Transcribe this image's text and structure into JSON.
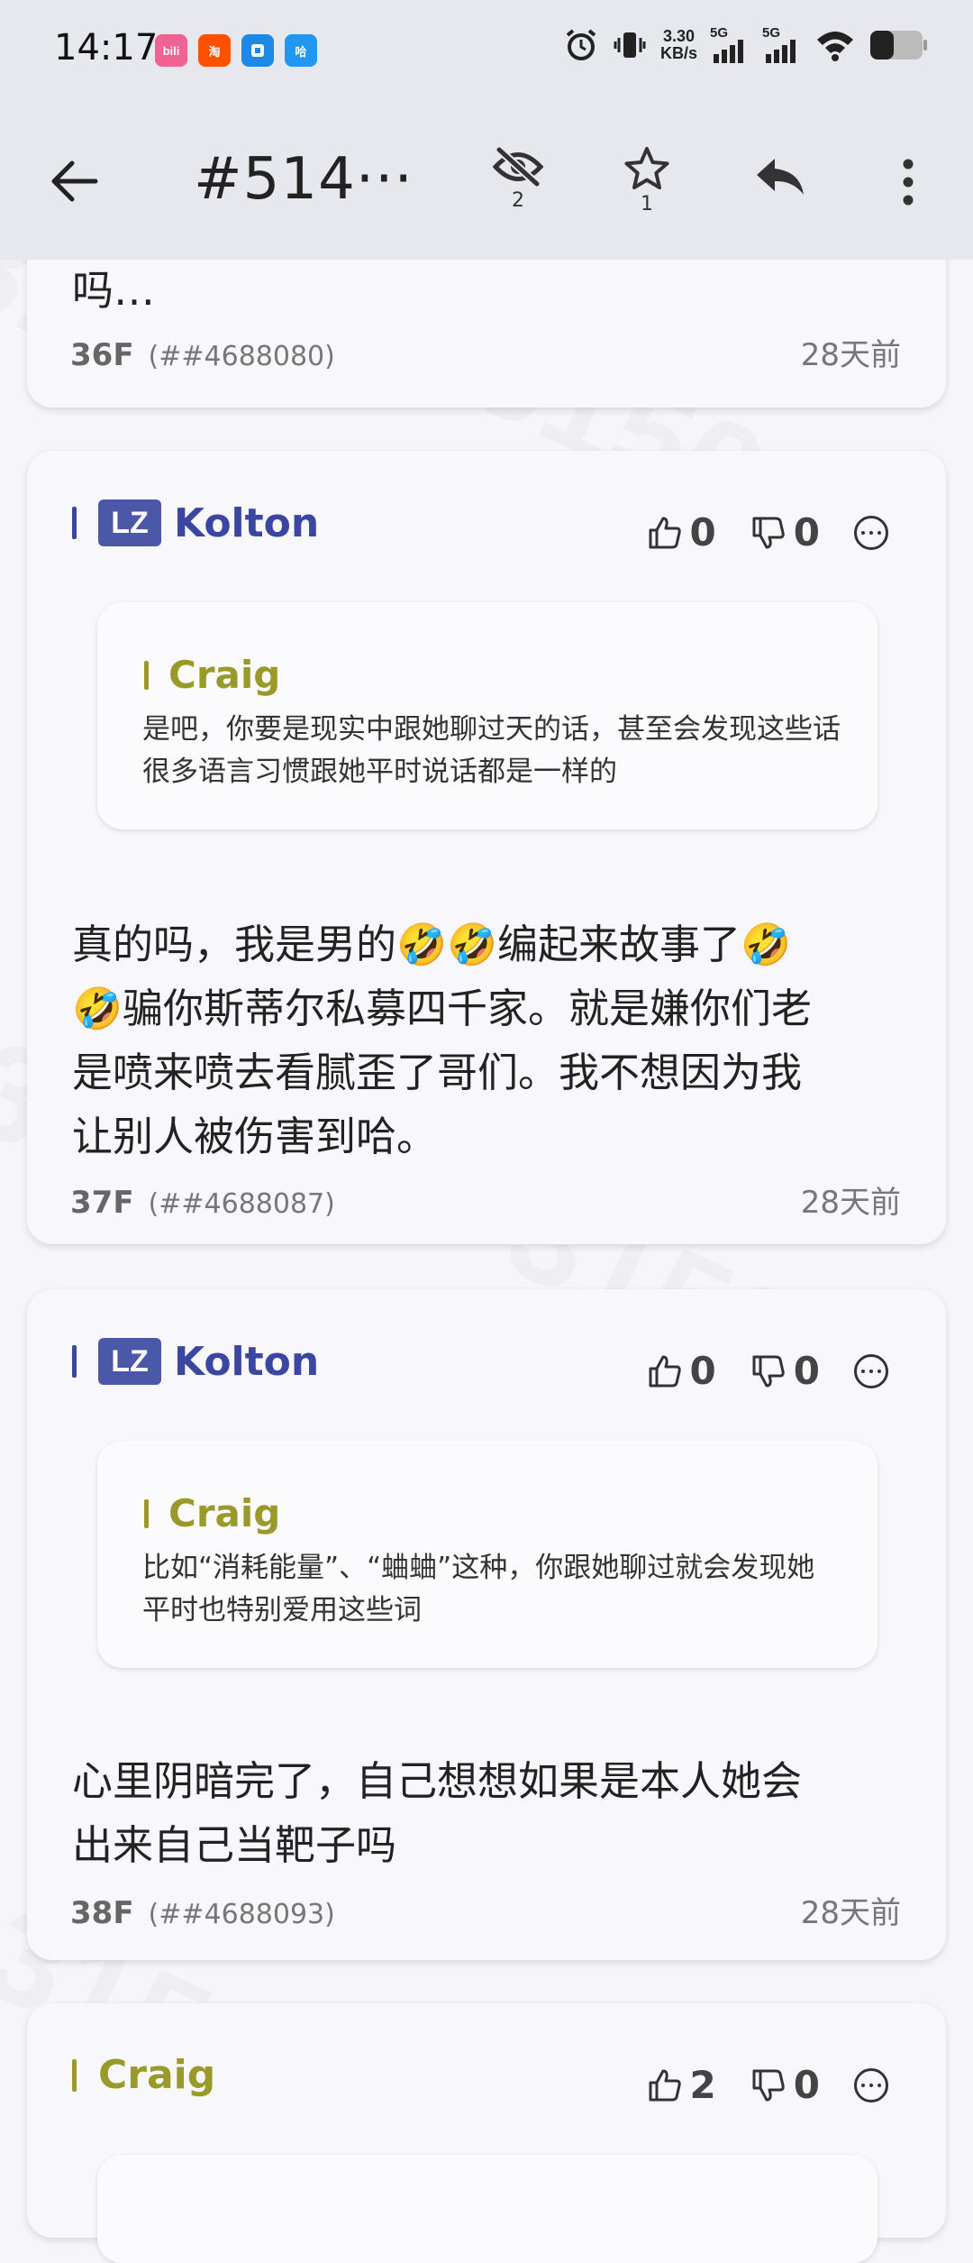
{
  "status_bar": {
    "time": "14:17",
    "apps": [
      {
        "name": "bilibili",
        "label": "bili",
        "color": "#f06292"
      },
      {
        "name": "taobao",
        "label": "淘",
        "color": "#ff5000"
      },
      {
        "name": "app3",
        "label": "",
        "color": "#1e88e5"
      },
      {
        "name": "app4",
        "label": "哈",
        "color": "#2196f3"
      }
    ],
    "net_speed_value": "3.30",
    "net_speed_unit": "KB/s",
    "sim1": "5G",
    "sim2": "5G"
  },
  "app_bar": {
    "title": "#514···",
    "views_count": "2",
    "star_count": "1"
  },
  "posts": [
    {
      "body_partial": "吗…",
      "floor": "36F",
      "id": "(##4688080)",
      "time": "28天前"
    },
    {
      "badge": "LZ",
      "author": "Kolton",
      "likes": "0",
      "dislikes": "0",
      "quote_author": "Craig",
      "quote_text": "是吧，你要是现实中跟她聊过天的话，甚至会发现这些话很多语言习惯跟她平时说话都是一样的",
      "body_line1": "真的吗，我是男的🤣🤣编起来故事了🤣",
      "body_line2": "🤣骗你斯蒂尔私募四千家。就是嫌你们老",
      "body_line3": "是喷来喷去看腻歪了哥们。我不想因为我",
      "body_line4": "让别人被伤害到哈。",
      "floor": "37F",
      "id": "(##4688087)",
      "time": "28天前"
    },
    {
      "badge": "LZ",
      "author": "Kolton",
      "likes": "0",
      "dislikes": "0",
      "quote_author": "Craig",
      "quote_text": "比如“消耗能量”、“蛐蛐”这种，你跟她聊过就会发现她平时也特别爱用这些词",
      "body_line1": "心里阴暗完了，自己想想如果是本人她会",
      "body_line2": "出来自己当靶子吗",
      "floor": "38F",
      "id": "(##4688093)",
      "time": "28天前"
    },
    {
      "author": "Craig",
      "likes": "2",
      "dislikes": "0"
    }
  ],
  "colors": {
    "lz_author": "#3a46a0",
    "other_author": "#9a9a2a",
    "header_bg": "#e6e8ed",
    "page_bg": "#f5f5fa"
  }
}
